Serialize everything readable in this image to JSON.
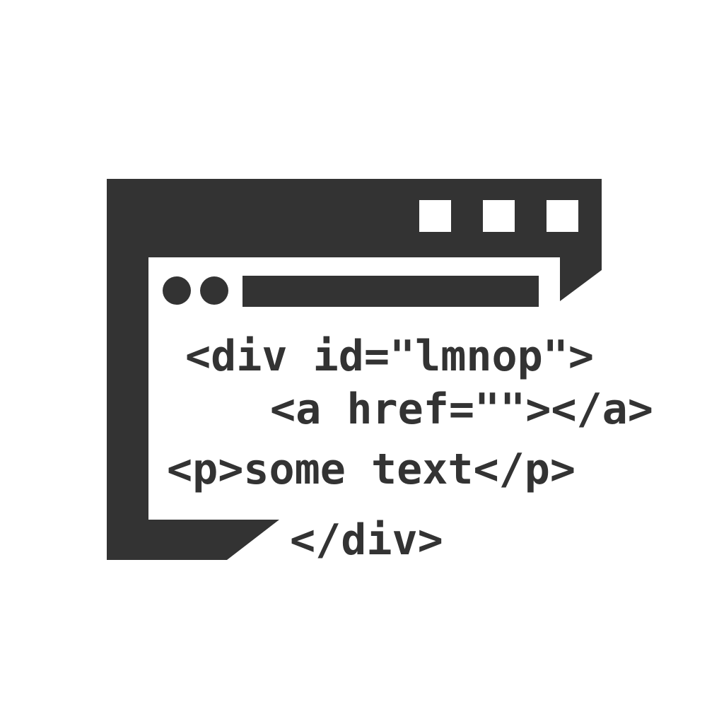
{
  "colors": {
    "ink": "#333333",
    "background": "#ffffff",
    "inner_panel": "#ffffff"
  },
  "icon": {
    "type": "browser-window-code-icon",
    "window_control_icons": [
      "square-icon",
      "square-icon",
      "square-icon"
    ],
    "address_bar_icons": [
      "dot-icon",
      "dot-icon",
      "address-bar-icon"
    ]
  },
  "code_lines": [
    "<div id=\"lmnop\">",
    "<a href=\"\"></a>",
    "<p>some text</p>",
    "</div>"
  ]
}
